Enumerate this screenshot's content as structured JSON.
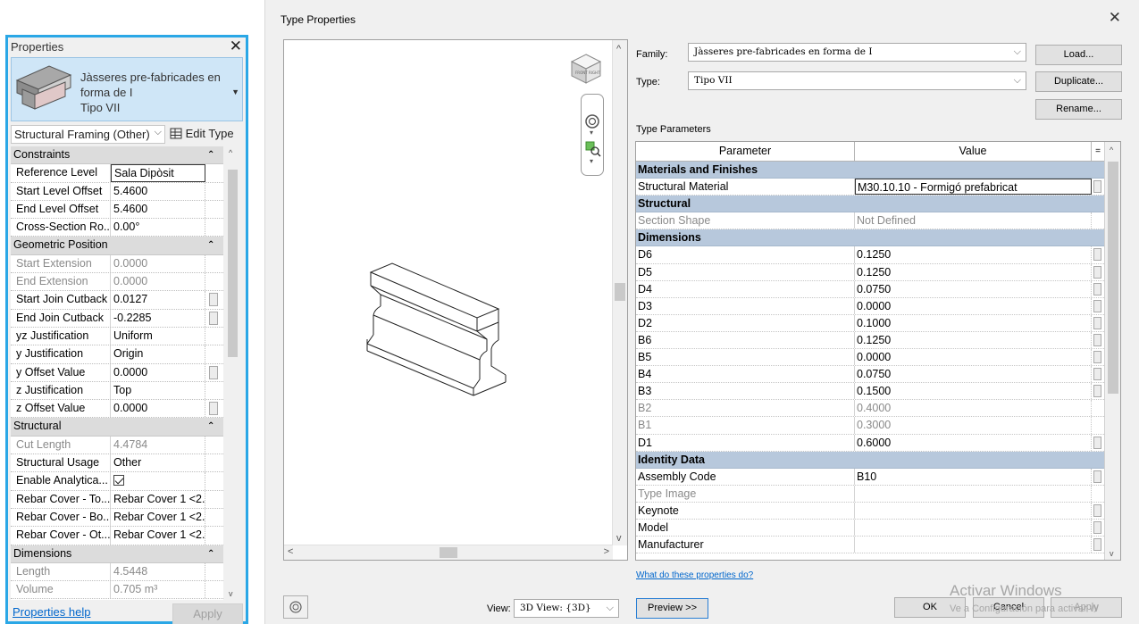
{
  "properties": {
    "title": "Properties",
    "type_name_line1": "Jàsseres pre-fabricades en",
    "type_name_line2": "forma de I",
    "type_name_line3": "Tipo VII",
    "category": "Structural Framing (Other)",
    "edit_type_label": "Edit Type",
    "rows": [
      {
        "kind": "group",
        "label": "Constraints"
      },
      {
        "kind": "param",
        "name": "Reference Level",
        "value": "Sala Dipòsit",
        "boxed": true
      },
      {
        "kind": "param",
        "name": "Start Level Offset",
        "value": "5.4600"
      },
      {
        "kind": "param",
        "name": "End Level Offset",
        "value": "5.4600"
      },
      {
        "kind": "param",
        "name": "Cross-Section Ro...",
        "value": "0.00°"
      },
      {
        "kind": "group",
        "label": "Geometric Position"
      },
      {
        "kind": "param",
        "name": "Start Extension",
        "value": "0.0000",
        "readonly": true
      },
      {
        "kind": "param",
        "name": "End Extension",
        "value": "0.0000",
        "readonly": true
      },
      {
        "kind": "param",
        "name": "Start Join Cutback",
        "value": "0.0127",
        "button": true
      },
      {
        "kind": "param",
        "name": "End Join Cutback",
        "value": "-0.2285",
        "button": true
      },
      {
        "kind": "param",
        "name": "yz Justification",
        "value": "Uniform"
      },
      {
        "kind": "param",
        "name": "y Justification",
        "value": "Origin"
      },
      {
        "kind": "param",
        "name": "y Offset Value",
        "value": "0.0000",
        "button": true
      },
      {
        "kind": "param",
        "name": "z Justification",
        "value": "Top"
      },
      {
        "kind": "param",
        "name": "z Offset Value",
        "value": "0.0000",
        "button": true
      },
      {
        "kind": "group",
        "label": "Structural"
      },
      {
        "kind": "param",
        "name": "Cut Length",
        "value": "4.4784",
        "readonly": true
      },
      {
        "kind": "param",
        "name": "Structural Usage",
        "value": "Other"
      },
      {
        "kind": "param",
        "name": "Enable Analytica...",
        "value": "",
        "checkbox": true
      },
      {
        "kind": "param",
        "name": "Rebar Cover - To...",
        "value": "Rebar Cover 1 <2..."
      },
      {
        "kind": "param",
        "name": "Rebar Cover - Bo...",
        "value": "Rebar Cover 1 <2..."
      },
      {
        "kind": "param",
        "name": "Rebar Cover - Ot...",
        "value": "Rebar Cover 1 <2..."
      },
      {
        "kind": "group",
        "label": "Dimensions"
      },
      {
        "kind": "param",
        "name": "Length",
        "value": "4.5448",
        "readonly": true
      },
      {
        "kind": "param",
        "name": "Volume",
        "value": "0.705 m³",
        "readonly": true
      }
    ],
    "help_link": "Properties help",
    "apply_label": "Apply"
  },
  "dialog": {
    "title": "Type Properties",
    "family_label": "Family:",
    "family_value": "Jàsseres pre-fabricades en forma de I",
    "type_label": "Type:",
    "type_value": "Tipo VII",
    "load_label": "Load...",
    "duplicate_label": "Duplicate...",
    "rename_label": "Rename...",
    "type_params_label": "Type Parameters",
    "col_parameter": "Parameter",
    "col_value": "Value",
    "col_extra": "=",
    "rows": [
      {
        "kind": "group",
        "label": "Materials and Finishes"
      },
      {
        "kind": "param",
        "name": "Structural Material",
        "value": "M30.10.10 - Formigó prefabricat",
        "boxed": true,
        "button": true
      },
      {
        "kind": "group",
        "label": "Structural"
      },
      {
        "kind": "param",
        "name": "Section Shape",
        "value": "Not Defined",
        "readonly": true
      },
      {
        "kind": "group",
        "label": "Dimensions"
      },
      {
        "kind": "param",
        "name": "D6",
        "value": "0.1250",
        "button": true
      },
      {
        "kind": "param",
        "name": "D5",
        "value": "0.1250",
        "button": true
      },
      {
        "kind": "param",
        "name": "D4",
        "value": "0.0750",
        "button": true
      },
      {
        "kind": "param",
        "name": "D3",
        "value": "0.0000",
        "button": true
      },
      {
        "kind": "param",
        "name": "D2",
        "value": "0.1000",
        "button": true
      },
      {
        "kind": "param",
        "name": "B6",
        "value": "0.1250",
        "button": true
      },
      {
        "kind": "param",
        "name": "B5",
        "value": "0.0000",
        "button": true
      },
      {
        "kind": "param",
        "name": "B4",
        "value": "0.0750",
        "button": true
      },
      {
        "kind": "param",
        "name": "B3",
        "value": "0.1500",
        "button": true
      },
      {
        "kind": "param",
        "name": "B2",
        "value": "0.4000",
        "readonly": true
      },
      {
        "kind": "param",
        "name": "B1",
        "value": "0.3000",
        "readonly": true
      },
      {
        "kind": "param",
        "name": "D1",
        "value": "0.6000",
        "button": true
      },
      {
        "kind": "group",
        "label": "Identity Data"
      },
      {
        "kind": "param",
        "name": "Assembly Code",
        "value": "B10",
        "button": true
      },
      {
        "kind": "param",
        "name": "Type Image",
        "value": "",
        "readonly": true
      },
      {
        "kind": "param",
        "name": "Keynote",
        "value": "",
        "button": true
      },
      {
        "kind": "param",
        "name": "Model",
        "value": "",
        "button": true
      },
      {
        "kind": "param",
        "name": "Manufacturer",
        "value": "",
        "button": true
      }
    ],
    "help_link": "What do these properties do?",
    "view_label": "View:",
    "view_value": "3D View: {3D}",
    "preview_label": "Preview >>",
    "ok_label": "OK",
    "cancel_label": "Cancel",
    "apply_label": "Apply",
    "watermark_line1": "Activar Windows",
    "watermark_line2": "Ve a Configuración para activar W"
  },
  "icons": {
    "close": "close-icon",
    "edit_type": "edit-type-icon",
    "steering_wheel": "steering-wheel-icon",
    "zoom": "zoom-region-icon",
    "view_cube": "view-cube-icon"
  },
  "colors": {
    "palette_border": "#2aa7e6",
    "group_header": "#b7c8dc",
    "link": "#0066cc"
  }
}
